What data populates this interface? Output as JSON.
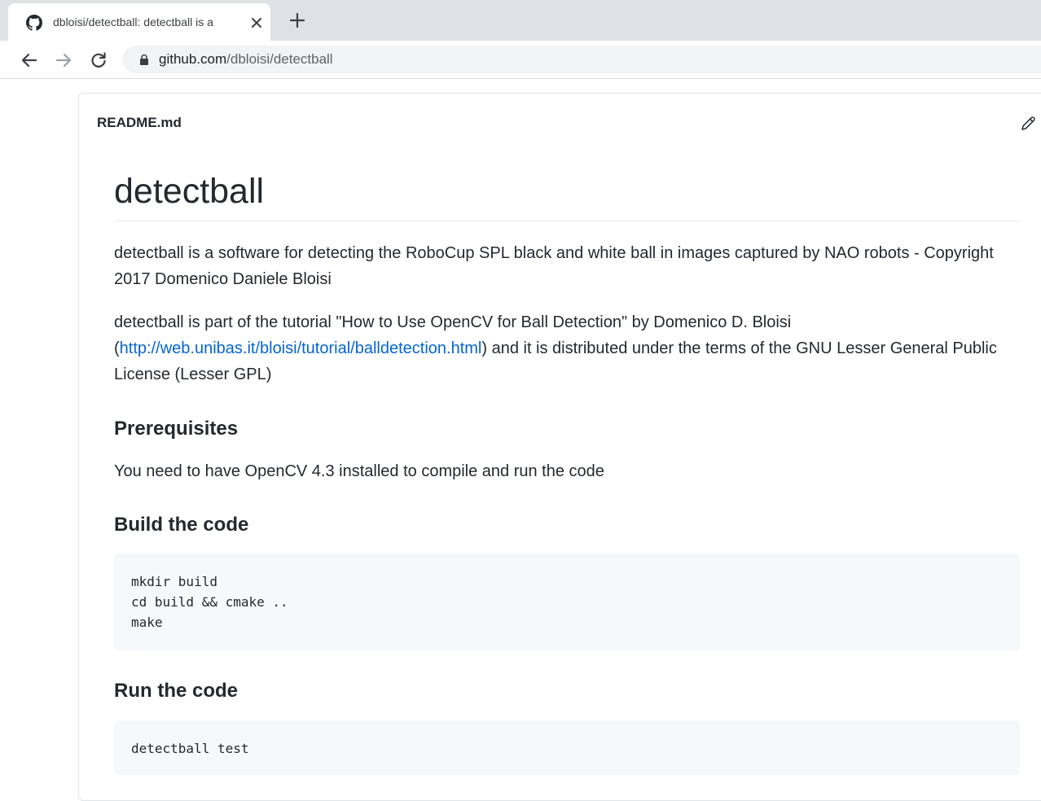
{
  "browser": {
    "tab": {
      "title": "dbloisi/detectball: detectball is a",
      "favicon": "github-icon",
      "close_icon": "close-icon"
    },
    "new_tab_icon": "plus-icon",
    "toolbar": {
      "back_icon": "back-arrow-icon",
      "forward_icon": "forward-arrow-icon",
      "reload_icon": "reload-icon"
    },
    "url": {
      "host": "github.com",
      "path": "/dbloisi/detectball",
      "lock_icon": "lock-icon"
    }
  },
  "readme": {
    "filename": "README.md",
    "edit_icon": "pencil-icon",
    "title": "detectball",
    "intro": "detectball is a software for detecting the RoboCup SPL black and white ball in images captured by NAO robots - Copyright 2017 Domenico Daniele Bloisi",
    "tutorial": {
      "before": "detectball is part of the tutorial \"How to Use OpenCV for Ball Detection\" by Domenico D. Bloisi (",
      "link": "http://web.unibas.it/bloisi/tutorial/balldetection.html",
      "after": ") and it is distributed under the terms of the GNU Lesser General Public License (Lesser GPL)"
    },
    "sections": {
      "prerequisites": {
        "heading": "Prerequisites",
        "text": "You need to have OpenCV 4.3 installed to compile and run the code"
      },
      "build": {
        "heading": "Build the code",
        "code": [
          "mkdir build",
          "cd build && cmake ..",
          "make"
        ]
      },
      "run": {
        "heading": "Run the code",
        "code": [
          "detectball test"
        ]
      }
    }
  },
  "colors": {
    "link": "#0366d6",
    "text": "#24292e",
    "code_bg": "#f6f8fa",
    "tabstrip": "#dee1e6"
  }
}
